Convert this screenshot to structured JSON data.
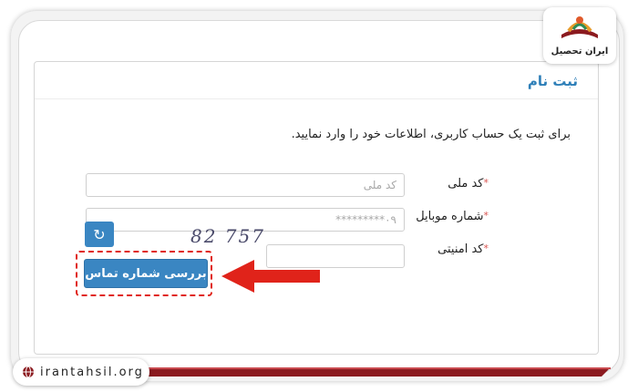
{
  "logo": {
    "name": "ایران تحصیل"
  },
  "panel": {
    "title": "ثبت نام",
    "intro": "برای ثبت یک حساب کاربری، اطلاعات خود را وارد نمایید."
  },
  "form": {
    "national_code": {
      "label": "کد ملی",
      "required_mark": "*",
      "placeholder": "کد ملی",
      "value": ""
    },
    "mobile": {
      "label": "شماره موبایل",
      "required_mark": "*",
      "placeholder": "۰۹*********",
      "value": ""
    },
    "security_code": {
      "label": "کد امنیتی",
      "required_mark": "*",
      "captcha_text": "82 757",
      "value": ""
    },
    "submit_label": "بررسی شماره تماس"
  },
  "footer": {
    "site": "irantahsil.org"
  },
  "colors": {
    "accent": "#3a86c2",
    "highlight": "#e0231a",
    "footer_bar": "#8b1a1f",
    "title": "#2e7fb8"
  },
  "icons": {
    "refresh": "refresh-icon",
    "globe": "globe-icon",
    "arrow": "arrow-left-icon"
  }
}
